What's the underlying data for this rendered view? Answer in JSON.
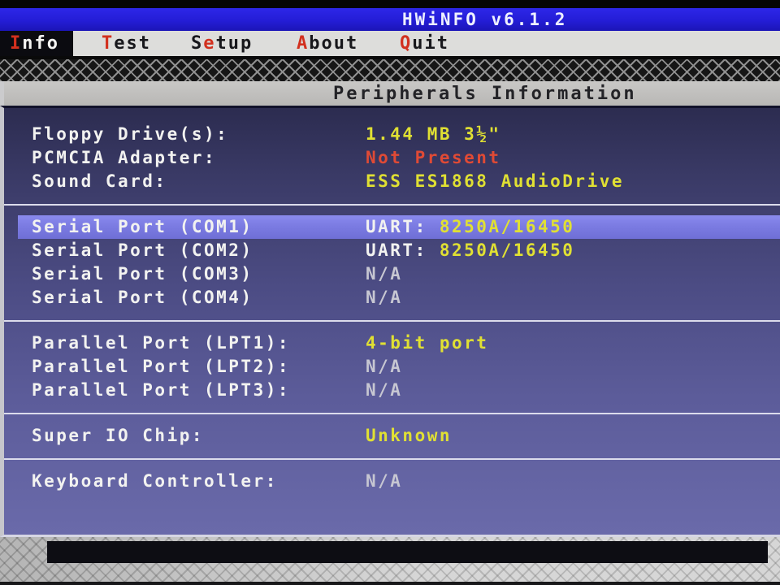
{
  "window": {
    "title": "HWiNFO v6.1.2"
  },
  "menu": {
    "items": [
      {
        "label": "Info",
        "pre": "",
        "hot": "I",
        "post": "nfo",
        "active": true
      },
      {
        "label": "Test",
        "pre": "",
        "hot": "T",
        "post": "est",
        "active": false
      },
      {
        "label": "Setup",
        "pre": "S",
        "hot": "e",
        "post": "tup",
        "active": false
      },
      {
        "label": "About",
        "pre": "",
        "hot": "A",
        "post": "bout",
        "active": false
      },
      {
        "label": "Quit",
        "pre": "",
        "hot": "Q",
        "post": "uit",
        "active": false
      }
    ]
  },
  "page": {
    "heading": "Peripherals Information"
  },
  "panel": {
    "sections": [
      {
        "rows": [
          {
            "label": "Floppy Drive(s):",
            "parts": [
              {
                "text": "1.44 MB 3½\"",
                "color": "yellow"
              }
            ]
          },
          {
            "label": "PCMCIA Adapter:",
            "parts": [
              {
                "text": "Not Present",
                "color": "red"
              }
            ]
          },
          {
            "label": "Sound Card:",
            "parts": [
              {
                "text": "ESS ES1868 AudioDrive",
                "color": "yellow"
              }
            ]
          }
        ]
      },
      {
        "rows": [
          {
            "label": "Serial Port (COM1)",
            "highlighted": true,
            "parts": [
              {
                "text": "UART: ",
                "color": "white"
              },
              {
                "text": "8250A/16450",
                "color": "yellow"
              }
            ]
          },
          {
            "label": "Serial Port (COM2)",
            "parts": [
              {
                "text": "UART: ",
                "color": "white"
              },
              {
                "text": "8250A/16450",
                "color": "yellow"
              }
            ]
          },
          {
            "label": "Serial Port (COM3)",
            "parts": [
              {
                "text": "N/A",
                "color": "gray"
              }
            ]
          },
          {
            "label": "Serial Port (COM4)",
            "parts": [
              {
                "text": "N/A",
                "color": "gray"
              }
            ]
          }
        ]
      },
      {
        "rows": [
          {
            "label": "Parallel Port (LPT1):",
            "parts": [
              {
                "text": "4-bit port",
                "color": "yellow"
              }
            ]
          },
          {
            "label": "Parallel Port (LPT2):",
            "parts": [
              {
                "text": "N/A",
                "color": "gray"
              }
            ]
          },
          {
            "label": "Parallel Port (LPT3):",
            "parts": [
              {
                "text": "N/A",
                "color": "gray"
              }
            ]
          }
        ]
      },
      {
        "rows": [
          {
            "label": "Super IO Chip:",
            "parts": [
              {
                "text": "Unknown",
                "color": "yellow"
              }
            ]
          }
        ]
      },
      {
        "rows": [
          {
            "label": "Keyboard Controller:",
            "parts": [
              {
                "text": "N/A",
                "color": "gray"
              }
            ]
          }
        ]
      }
    ]
  },
  "colors": {
    "titlebar": "#241dd6",
    "hot": "#d2301e",
    "highlight": "#7b7be2",
    "yellow": "#e0e033",
    "red": "#e04a35",
    "gray": "#c7c7d2",
    "white": "#f2f2f0"
  }
}
